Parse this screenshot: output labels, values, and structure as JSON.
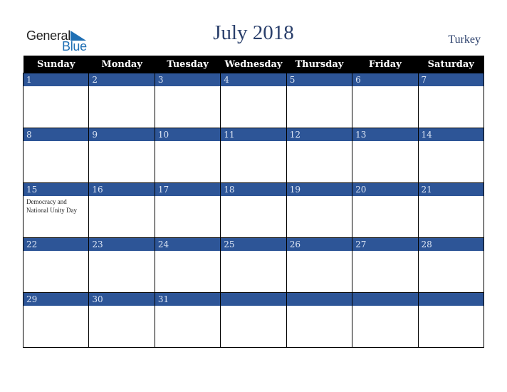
{
  "logo": {
    "word1": "General",
    "word2": "Blue",
    "accent": "#1f6fb4"
  },
  "title": "July 2018",
  "country": "Turkey",
  "colors": {
    "header_bg": "#000000",
    "band": "#2d5597",
    "title": "#2a3f6b"
  },
  "weekdays": [
    "Sunday",
    "Monday",
    "Tuesday",
    "Wednesday",
    "Thursday",
    "Friday",
    "Saturday"
  ],
  "weeks": [
    [
      {
        "day": "1"
      },
      {
        "day": "2"
      },
      {
        "day": "3"
      },
      {
        "day": "4"
      },
      {
        "day": "5"
      },
      {
        "day": "6"
      },
      {
        "day": "7"
      }
    ],
    [
      {
        "day": "8"
      },
      {
        "day": "9"
      },
      {
        "day": "10"
      },
      {
        "day": "11"
      },
      {
        "day": "12"
      },
      {
        "day": "13"
      },
      {
        "day": "14"
      }
    ],
    [
      {
        "day": "15",
        "event": "Democracy and National Unity Day"
      },
      {
        "day": "16"
      },
      {
        "day": "17"
      },
      {
        "day": "18"
      },
      {
        "day": "19"
      },
      {
        "day": "20"
      },
      {
        "day": "21"
      }
    ],
    [
      {
        "day": "22"
      },
      {
        "day": "23"
      },
      {
        "day": "24"
      },
      {
        "day": "25"
      },
      {
        "day": "26"
      },
      {
        "day": "27"
      },
      {
        "day": "28"
      }
    ],
    [
      {
        "day": "29"
      },
      {
        "day": "30"
      },
      {
        "day": "31"
      },
      {
        "day": ""
      },
      {
        "day": ""
      },
      {
        "day": ""
      },
      {
        "day": ""
      }
    ]
  ]
}
